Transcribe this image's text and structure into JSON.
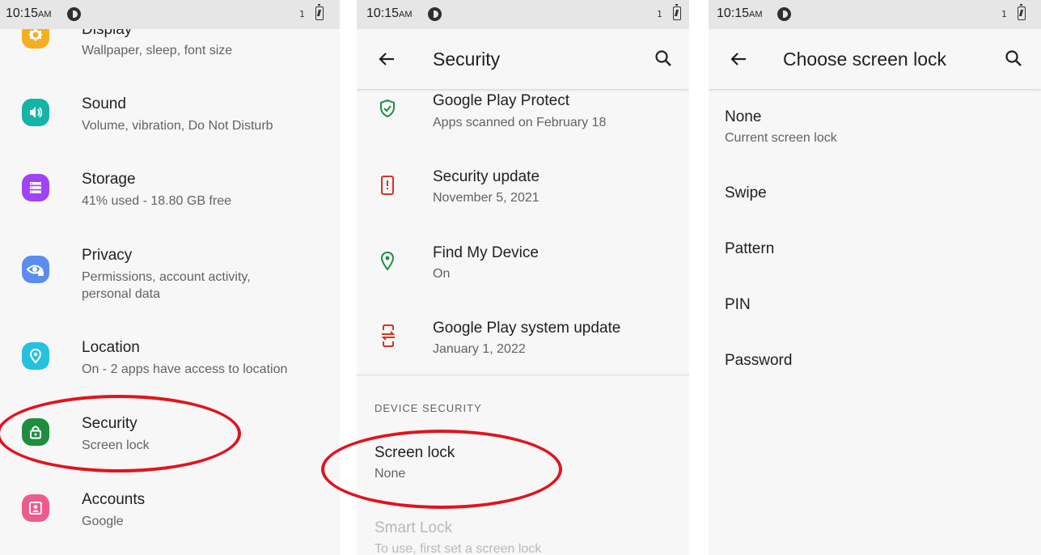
{
  "status": {
    "time": "10:15",
    "ampm": "AM",
    "sim": "1"
  },
  "panel1": {
    "items": [
      {
        "title": "Display",
        "subtitle": "Wallpaper, sleep, font size",
        "icon": "display-icon",
        "color": "#f6ae1e"
      },
      {
        "title": "Sound",
        "subtitle": "Volume, vibration, Do Not Disturb",
        "icon": "sound-icon",
        "color": "#12b5a6"
      },
      {
        "title": "Storage",
        "subtitle": "41% used - 18.80 GB free",
        "icon": "storage-icon",
        "color": "#a142f4"
      },
      {
        "title": "Privacy",
        "subtitle": "Permissions, account activity, personal data",
        "icon": "privacy-icon",
        "color": "#5b8def"
      },
      {
        "title": "Location",
        "subtitle": "On - 2 apps have access to location",
        "icon": "location-icon",
        "color": "#24c1e0"
      },
      {
        "title": "Security",
        "subtitle": "Screen lock",
        "icon": "lock-icon",
        "color": "#1e8e3e"
      },
      {
        "title": "Accounts",
        "subtitle": "Google",
        "icon": "account-icon",
        "color": "#ee5b8f"
      }
    ]
  },
  "panel2": {
    "title": "Security",
    "items": [
      {
        "title": "Google Play Protect",
        "subtitle": "Apps scanned on February 18",
        "icon": "shield-check-icon",
        "color": "#1e8e3e"
      },
      {
        "title": "Security update",
        "subtitle": "November 5, 2021",
        "icon": "phone-alert-icon",
        "color": "#d93025"
      },
      {
        "title": "Find My Device",
        "subtitle": "On",
        "icon": "location-pin-icon",
        "color": "#1e8e3e"
      },
      {
        "title": "Google Play system update",
        "subtitle": "January 1, 2022",
        "icon": "phone-update-icon",
        "color": "#d93025"
      }
    ],
    "section_header": "DEVICE SECURITY",
    "screen_lock": {
      "title": "Screen lock",
      "subtitle": "None"
    },
    "smart_lock": {
      "title": "Smart Lock",
      "subtitle": "To use, first set a screen lock"
    }
  },
  "panel3": {
    "title": "Choose screen lock",
    "options": [
      {
        "title": "None",
        "subtitle": "Current screen lock"
      },
      {
        "title": "Swipe",
        "subtitle": ""
      },
      {
        "title": "Pattern",
        "subtitle": ""
      },
      {
        "title": "PIN",
        "subtitle": ""
      },
      {
        "title": "Password",
        "subtitle": ""
      }
    ]
  },
  "colors": {
    "annotation": "#e0141e",
    "statusbar": "#e6e6e6",
    "background": "#f7f7f7"
  }
}
